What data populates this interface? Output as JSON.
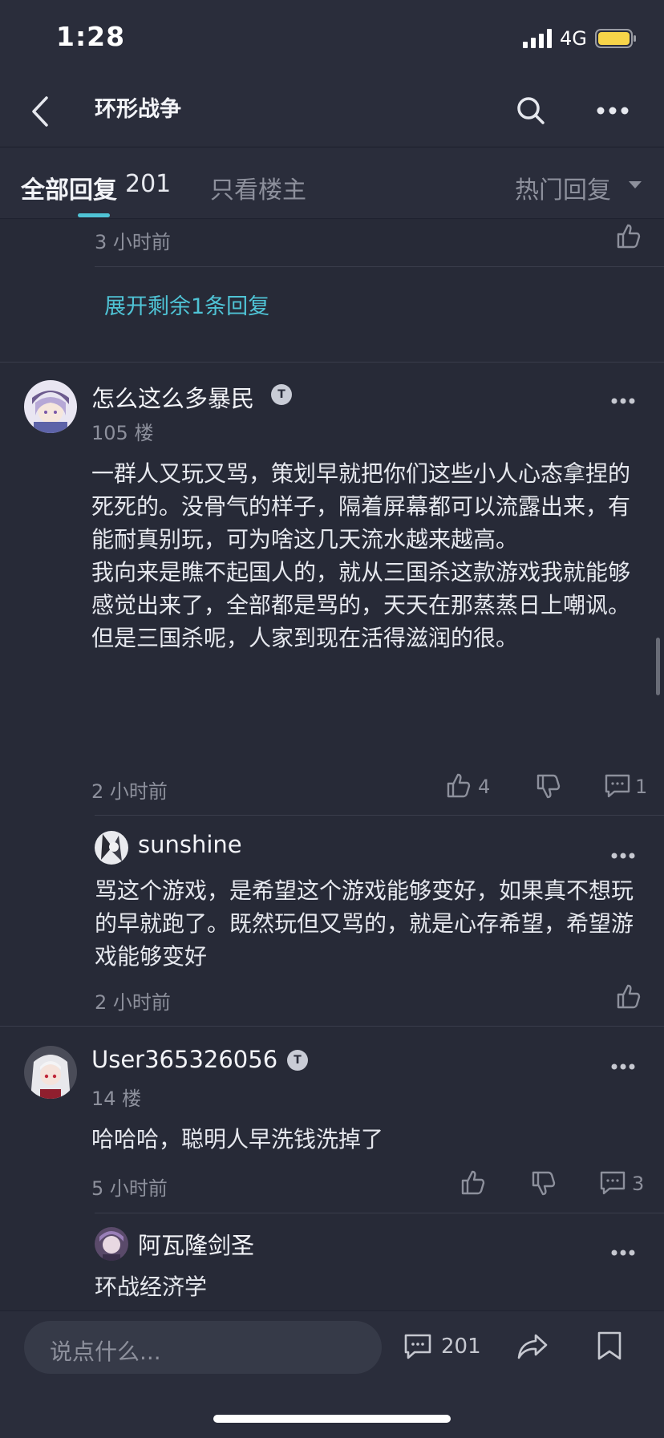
{
  "status": {
    "time": "1:28",
    "network": "4G"
  },
  "nav": {
    "title": "环形战争"
  },
  "tabs": {
    "all_label": "全部回复",
    "all_count": "201",
    "owner_only": "只看楼主",
    "sort": "热门回复"
  },
  "prev_reply": {
    "time": "3 小时前"
  },
  "expand": {
    "label": "展开剩余1条回复"
  },
  "posts": [
    {
      "username": "怎么这么多暴民",
      "floor": "105 楼",
      "content": "一群人又玩又骂，策划早就把你们这些小人心态拿捏的死死的。没骨气的样子，隔着屏幕都可以流露出来，有能耐真别玩，可为啥这几天流水越来越高。\n我向来是瞧不起国人的，就从三国杀这款游戏我就能够感觉出来了，全部都是骂的，天天在那蒸蒸日上嘲讽。但是三国杀呢，人家到现在活得滋润的很。",
      "time": "2 小时前",
      "likes": "4",
      "comments": "1",
      "reply": {
        "username": "sunshine",
        "content": "骂这个游戏，是希望这个游戏能够变好，如果真不想玩的早就跑了。既然玩但又骂的，就是心存希望，希望游戏能够变好",
        "time": "2 小时前"
      }
    },
    {
      "username": "User365326056",
      "floor": "14 楼",
      "content": "哈哈哈，聪明人早洗钱洗掉了",
      "time": "5 小时前",
      "comments": "3",
      "reply": {
        "username": "阿瓦隆剑圣",
        "content": "环战经济学"
      }
    }
  ],
  "bottom": {
    "input_placeholder": "说点什么...",
    "comment_count": "201"
  },
  "colors": {
    "background": "#272a37",
    "accent": "#4fc3d5",
    "battery": "#f7d449"
  }
}
